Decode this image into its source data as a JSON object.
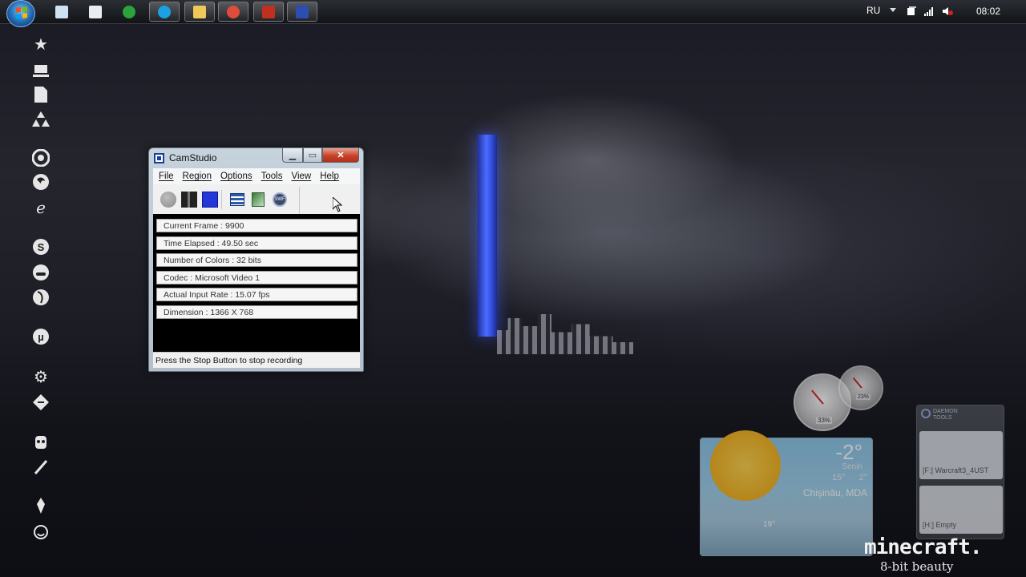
{
  "taskbar": {
    "buttons": [
      {
        "name": "notepad",
        "color": "#cfe2f3"
      },
      {
        "name": "document",
        "color": "#e9eef5"
      },
      {
        "name": "utorrent",
        "color": "#2aa33a"
      },
      {
        "name": "skype",
        "color": "#1ba1e2"
      },
      {
        "name": "explorer",
        "color": "#f0c85a"
      },
      {
        "name": "chrome",
        "color": "#e04b3a"
      },
      {
        "name": "media",
        "color": "#c03020"
      },
      {
        "name": "camstudio",
        "color": "#2a4fb0"
      }
    ],
    "language": "RU",
    "clock": "08:02"
  },
  "camstudio": {
    "title": "CamStudio",
    "menu": [
      "File",
      "Region",
      "Options",
      "Tools",
      "View",
      "Help"
    ],
    "toolbar": {
      "swf_label": "SWF"
    },
    "info": [
      "Current Frame : 9900",
      "Time Elapsed : 49.50 sec",
      "Number of Colors : 32 bits",
      "Codec : Microsoft Video 1",
      "Actual Input Rate : 15.07 fps",
      "Dimension : 1366 X 768"
    ],
    "status": "Press the Stop Button to stop recording"
  },
  "weather": {
    "temp": "-2°",
    "condition": "Senin",
    "high": "15°",
    "low": "2°",
    "city": "Chişinău, MDA",
    "small_temp": "19°"
  },
  "meter": {
    "cpu": "33%",
    "ram": "23%"
  },
  "daemon": {
    "title": "DAEMON TOOLS",
    "drive1": "[F:] Warcraft3_4UST",
    "drive2": "[H:] Empty"
  },
  "branding": {
    "title": "minecraft.",
    "subtitle": "8-bit beauty"
  },
  "colors": {
    "beam": "#4a6cff",
    "window_frame": "#b3c0cc",
    "close_button": "#c8422a",
    "stop_button": "#2437d8"
  }
}
